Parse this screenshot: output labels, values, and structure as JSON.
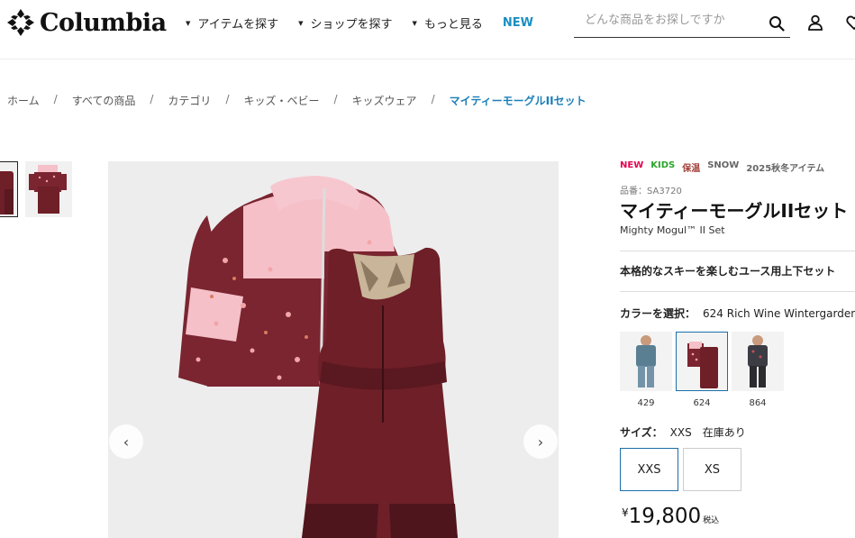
{
  "brand": {
    "logo_text": "Columbia"
  },
  "nav": {
    "items": [
      "アイテムを探す",
      "ショップを探す",
      "もっと見る"
    ],
    "new_label": "NEW"
  },
  "search": {
    "placeholder": "どんな商品をお探しですか"
  },
  "breadcrumb": {
    "items": [
      "ホーム",
      "すべての商品",
      "カテゴリ",
      "キッズ・ベビー",
      "キッズウェア"
    ],
    "current": "マイティーモーグルIIセット",
    "separator": "/"
  },
  "gallery": {
    "prev_label": "‹",
    "next_label": "›"
  },
  "product": {
    "tags": {
      "new": "NEW",
      "kids": "KIDS",
      "hoon": "保温",
      "snow": "SNOW",
      "season": "2025秋冬アイテム"
    },
    "sku": "品番：SA3720",
    "title": "マイティーモーグルIIセット",
    "subtitle": "Mighty Mogul™ II Set",
    "catch_copy": "本格的なスキーを楽しむユース用上下セット",
    "color_label": "カラーを選択：",
    "color_value": "624 Rich Wine Wintergarden",
    "swatches": [
      {
        "code": "429",
        "color": "#5a7e92"
      },
      {
        "code": "624",
        "color": "#6e1f27"
      },
      {
        "code": "864",
        "color": "#3c3c44"
      }
    ],
    "size_label": "サイズ：",
    "size_value": "XXS　在庫あり",
    "sizes": [
      "XXS",
      "XS"
    ],
    "price_yen": "¥",
    "price": "19,800",
    "price_tax": "税込"
  },
  "colors": {
    "accent": "#1a7fb8",
    "wine": "#6e1f27",
    "pink": "#f5c0c8"
  }
}
